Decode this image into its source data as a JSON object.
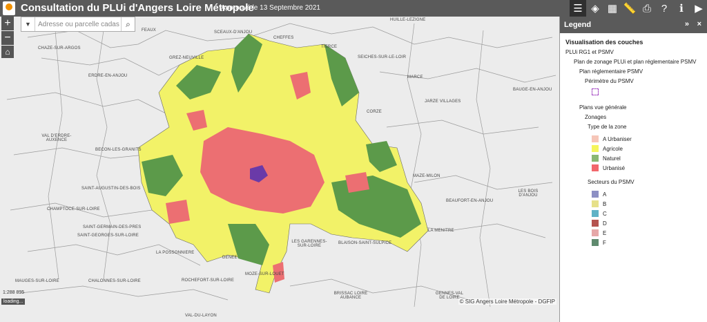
{
  "header": {
    "title": "Consultation du PLUi d'Angers Loire Métropole",
    "subtitle": "Approuvé le 13 Septembre 2021",
    "tools": [
      {
        "name": "legend-tool",
        "glyph": "☰"
      },
      {
        "name": "layers-tool",
        "glyph": "◈"
      },
      {
        "name": "basemap-tool",
        "glyph": "▦"
      },
      {
        "name": "measure-tool",
        "glyph": "📏"
      },
      {
        "name": "print-tool",
        "glyph": "⎙"
      },
      {
        "name": "help-tool",
        "glyph": "?"
      },
      {
        "name": "info-tool",
        "glyph": "ℹ"
      },
      {
        "name": "play-tool",
        "glyph": "▶"
      }
    ]
  },
  "search": {
    "placeholder": "Adresse ou parcelle cadast",
    "dropdown_glyph": "▼",
    "search_glyph": "⌕"
  },
  "controls": {
    "zoom_in": "+",
    "zoom_out": "−",
    "home": "⌂"
  },
  "map": {
    "scale": "1:288 895",
    "loading": "loading...",
    "attribution": "© SIG Angers Loire Métropole - DGFIP",
    "places": [
      "HUILLE-LEZIGNE",
      "CHAZE-SUR-ARGOS",
      "FEAUX",
      "SCEAUX-D'ANJOU",
      "CHEFFES",
      "GREZ-NEUVILLE",
      "TIERCE",
      "SEICHES-SUR-LE-LOIR",
      "ERDRE-EN-ANJOU",
      "MARCE",
      "BAUGE-EN-ANJOU",
      "JARZE VILLAGES",
      "CORZE",
      "VAL D'ERDRE-AUXENCE",
      "BECON-LES-GRANITS",
      "SAINT-AUGUSTIN-DES-BOIS",
      "MAZE-MILON",
      "LES BOIS D'ANJOU",
      "CHAMPTOCE-SUR-LOIRE",
      "BEAUFORT-EN-ANJOU",
      "SAINT-GERMAIN-DES-PRES",
      "SAINT-GEORGES-SUR-LOIRE",
      "LA MENITRE",
      "LES GARENNES-SUR-LOIRE",
      "BLAISON-SAINT-SULPICE",
      "LA POSSONNIERE",
      "DENEE",
      "MAUGES-SUR-LOIRE",
      "CHALONNES-SUR-LOIRE",
      "ROCHEFORT-SUR-LOIRE",
      "MOZE-SUR-LOUET",
      "BRISSAC LOIRE AUBANCE",
      "GENNES-VAL DE LOIRE",
      "VAL-DU-LAYON"
    ]
  },
  "legend": {
    "title": "Legend",
    "collapse_glyph": "»",
    "close_glyph": "×",
    "heading": "Visualisation des couches",
    "group1": "PLUi RG1 et PSMV",
    "group1_sub": "Plan de zonage PLUi et plan réglementaire PSMV",
    "group1_sub2": "Plan réglementaire PSMV",
    "perimetre": "Périmètre du PSMV",
    "group2": "Plans vue générale",
    "zonages": "Zonages",
    "type_zone": "Type de la zone",
    "zones": [
      {
        "label": "A Urbaniser",
        "color": "#f6c6b8"
      },
      {
        "label": "Agricole",
        "color": "#f5f55c"
      },
      {
        "label": "Naturel",
        "color": "#8ab872"
      },
      {
        "label": "Urbanisé",
        "color": "#f2676c"
      }
    ],
    "secteurs_title": "Secteurs du PSMV",
    "secteurs": [
      {
        "label": "A",
        "color": "#8c8fc4"
      },
      {
        "label": "B",
        "color": "#e6e089"
      },
      {
        "label": "C",
        "color": "#5fb2c6"
      },
      {
        "label": "D",
        "color": "#b5534f"
      },
      {
        "label": "E",
        "color": "#e6a8a8"
      },
      {
        "label": "F",
        "color": "#5f8a6e"
      }
    ]
  },
  "colors": {
    "header": "#5a5a5a",
    "agricole": "#f2f268",
    "naturel": "#5c9a4a",
    "urbanise": "#ec6f72",
    "psmv": "#6a3aa8"
  }
}
